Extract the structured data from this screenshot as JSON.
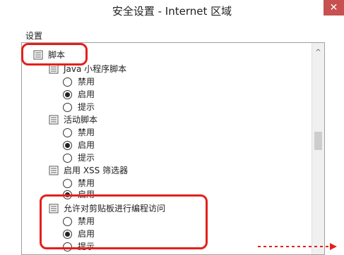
{
  "window": {
    "title": "安全设置 - Internet 区域",
    "close_glyph": "✕"
  },
  "settings": {
    "section_label": "设置",
    "category": "脚本",
    "groups": [
      {
        "title": "Java 小程序脚本",
        "options": [
          "禁用",
          "启用",
          "提示"
        ],
        "selected": 1
      },
      {
        "title": "活动脚本",
        "options": [
          "禁用",
          "启用",
          "提示"
        ],
        "selected": 1
      },
      {
        "title": "启用 XSS 筛选器",
        "options": [
          "禁用",
          "启用"
        ],
        "selected": 1
      },
      {
        "title": "允许对剪贴板进行编程访问",
        "options": [
          "禁用",
          "启用",
          "提示"
        ],
        "selected": 1
      }
    ]
  },
  "scrollbar": {
    "up_glyph": "^"
  },
  "colors": {
    "highlight": "#e3201b",
    "arrow": "#e3201b"
  }
}
